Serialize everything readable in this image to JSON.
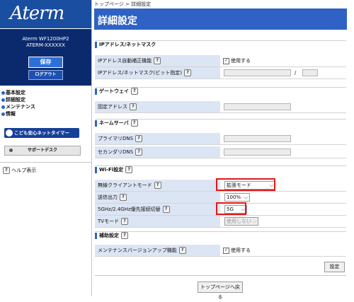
{
  "sidebar": {
    "logo": "Aterm",
    "model": "Aterm  WF1200HP2",
    "device_id": "ATERM-XXXXXX",
    "save_label": "保存",
    "logout_label": "ログアウト",
    "nav": [
      "基本設定",
      "詳細設定",
      "メンテナンス",
      "情報"
    ],
    "kids_label": "こども安心ネットタイマー",
    "support_label": "サポートデスク",
    "help_label": "ヘルプ表示"
  },
  "breadcrumb": "トップページ > 詳細設定",
  "page_title": "詳細設定",
  "help_mark": "?",
  "sections": {
    "ip": {
      "title": "IPアドレス/ネットマスク",
      "rows": [
        {
          "label": "IPアドレス自動補正機能",
          "value": "使用する"
        },
        {
          "label": "IPアドレス/ネットマスク(ビット指定)",
          "separator": "/"
        }
      ]
    },
    "gateway": {
      "title": "ゲートウェイ",
      "rows": [
        {
          "label": "固定アドレス"
        }
      ]
    },
    "dns": {
      "title": "ネームサーバ",
      "rows": [
        {
          "label": "プライマリDNS"
        },
        {
          "label": "セカンダリDNS"
        }
      ]
    },
    "wifi": {
      "title": "Wi-Fi設定",
      "rows": [
        {
          "label": "無線クライアントモード",
          "value": "拡張モード"
        },
        {
          "label": "送信出力",
          "value": "100%"
        },
        {
          "label": "5GHz/2.4GHz優先接続切替",
          "value": "5G"
        },
        {
          "label": "TVモード",
          "value": "使用しない"
        }
      ]
    },
    "aux": {
      "title": "補助設定",
      "rows": [
        {
          "label": "メンテナンスバージョンアップ機能",
          "value": "使用する"
        }
      ]
    }
  },
  "buttons": {
    "set": "設定",
    "back": "トップページへ戻る"
  },
  "check_mark": "✓",
  "arrow": "⌵"
}
